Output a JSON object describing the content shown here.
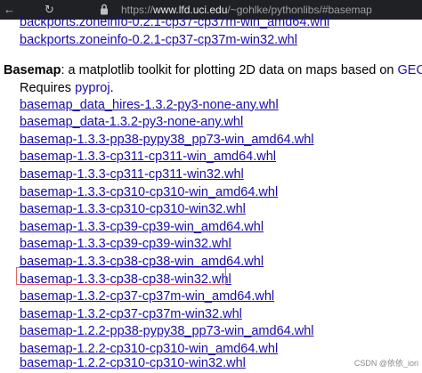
{
  "browser": {
    "url_scheme": "https://",
    "url_host": "www.lfd.uci.edu",
    "url_path": "/~gohlke/pythonlibs/#basemap"
  },
  "prev_links": [
    "backports.zoneinfo-0.2.1-cp37-cp37m-win_amd64.whl",
    "backports.zoneinfo-0.2.1-cp37-cp37m-win32.whl"
  ],
  "basemap": {
    "name": "Basemap",
    "desc_line1": ": a matplotlib toolkit for plotting 2D data on maps based on ",
    "geos_link": "GEOS",
    "desc_end1": ".",
    "desc_line2": "Requires ",
    "pyproj_link": "pyproj",
    "desc_end2": ".",
    "links": [
      "basemap_data_hires-1.3.2-py3-none-any.whl",
      "basemap_data-1.3.2-py3-none-any.whl",
      "basemap-1.3.3-pp38-pypy38_pp73-win_amd64.whl",
      "basemap-1.3.3-cp311-cp311-win_amd64.whl",
      "basemap-1.3.3-cp311-cp311-win32.whl",
      "basemap-1.3.3-cp310-cp310-win_amd64.whl",
      "basemap-1.3.3-cp310-cp310-win32.whl",
      "basemap-1.3.3-cp39-cp39-win_amd64.whl",
      "basemap-1.3.3-cp39-cp39-win32.whl",
      "basemap-1.3.3-cp38-cp38-win_amd64.whl",
      "basemap-1.3.3-cp38-cp38-win32.whl",
      "basemap-1.3.2-cp37-cp37m-win_amd64.whl",
      "basemap-1.3.2-cp37-cp37m-win32.whl",
      "basemap-1.2.2-pp38-pypy38_pp73-win_amd64.whl",
      "basemap-1.2.2-cp310-cp310-win_amd64.whl",
      "basemap-1.2.2-cp310-cp310-win32.whl"
    ]
  },
  "watermark": "CSDN @依依_iori",
  "colors": {
    "link": "#1a0dab",
    "highlight": "#e06666",
    "browser_bar": "#202124"
  }
}
